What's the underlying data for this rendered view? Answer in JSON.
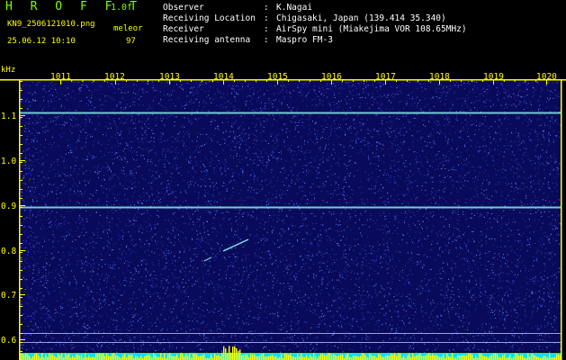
{
  "header": {
    "brand": "H R O F F T",
    "version": "1.0f",
    "filename": "KN9_2506121010.png",
    "mode": "meleor",
    "datetime": "25.06.12 10:10",
    "count": "97"
  },
  "meta": [
    {
      "key": "Observer",
      "value": "K.Nagai"
    },
    {
      "key": "Receiving Location",
      "value": "Chigasaki, Japan (139.414 35.340)"
    },
    {
      "key": "Receiver",
      "value": "AirSpy mini (Miakejima VOR 108.65MHz)"
    },
    {
      "key": "Receiving antenna",
      "value": "Maspro FM-3"
    }
  ],
  "spectrogram": {
    "y_unit": "kHz",
    "x_ticks": [
      "1011",
      "1012",
      "1013",
      "1014",
      "1015",
      "1016",
      "1017",
      "1018",
      "1019",
      "1020"
    ],
    "y_ticks": [
      "1.1",
      "1.0",
      "0.9",
      "0.8",
      "0.7",
      "0.6"
    ],
    "colors": {
      "background": "#0a0a5a",
      "noise": "#3050d0",
      "line": "#80e0e0",
      "axis": "#ffff00",
      "signal": "#ffff00",
      "floor": "#00e0ff"
    }
  }
}
